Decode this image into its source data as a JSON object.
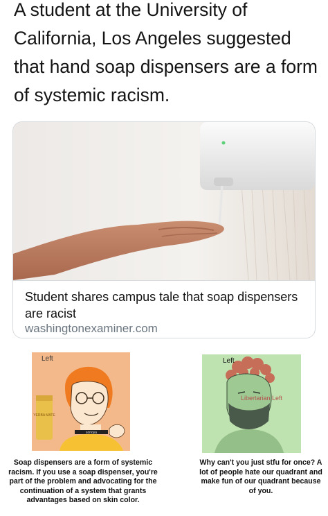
{
  "tweet": {
    "text": "A student at the University of California, Los Angeles suggested that hand soap dispensers are a form of systemic racism."
  },
  "link_card": {
    "headline": "Student shares campus tale that soap dispensers are racist",
    "source": "washingtonexaminer.com",
    "image": "hand-under-soap-dispenser"
  },
  "meme": {
    "left_panel": {
      "quadrant_label": "Left",
      "can_text": "YERBA MATE",
      "choker_text": "sonoya",
      "caption": "Soap dispensers are a form of systemic racism. If you use a soap dispenser, you're part of the problem and advocating for the continuation of a system that grants advantages based on skin color.",
      "bg_color": "#f4b98a"
    },
    "right_panel": {
      "quadrant_label": "Left",
      "sub_label": "Libertarian Left",
      "caption": "Why can't you just stfu for once? A lot of people hate our quadrant and make fun of our quadrant because of you.",
      "bg_color": "#bfe3b0"
    }
  }
}
